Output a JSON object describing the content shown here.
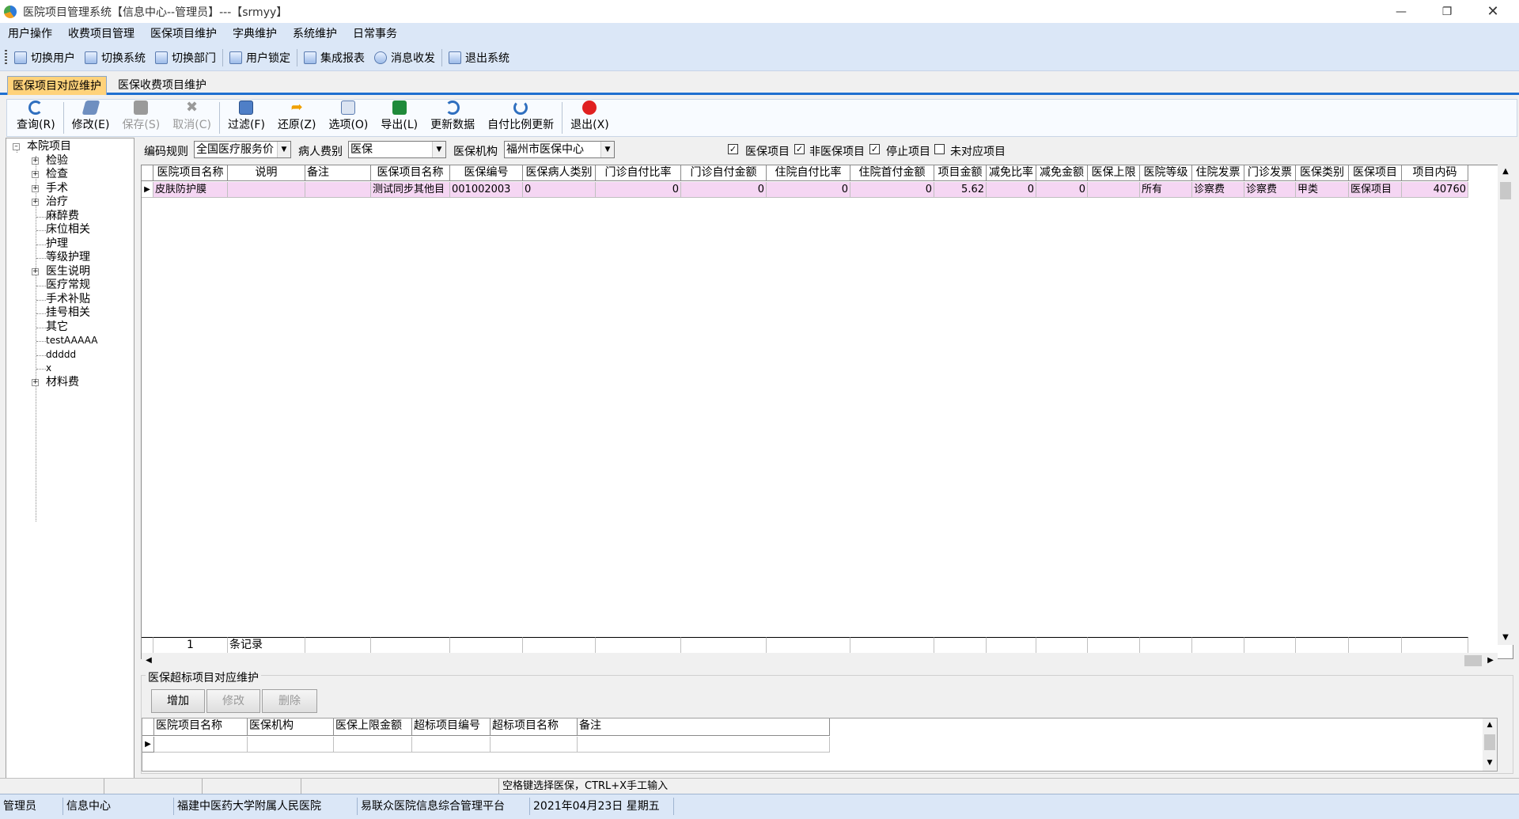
{
  "window": {
    "title": "医院项目管理系统【信息中心--管理员】---【srmyy】"
  },
  "menu": [
    "用户操作",
    "收费项目管理",
    "医保项目维护",
    "字典维护",
    "系统维护",
    "日常事务"
  ],
  "system_toolbar": [
    "切换用户",
    "切换系统",
    "切换部门",
    "用户锁定",
    "集成报表",
    "消息收发",
    "退出系统"
  ],
  "tabs": [
    "医保项目对应维护",
    "医保收费项目维护"
  ],
  "toolbar": {
    "query": "查询(R)",
    "edit": "修改(E)",
    "save": "保存(S)",
    "cancel": "取消(C)",
    "filter": "过滤(F)",
    "restore": "还原(Z)",
    "options": "选项(O)",
    "export": "导出(L)",
    "refresh": "更新数据",
    "ratio_update": "自付比例更新",
    "exit": "退出(X)"
  },
  "tree": {
    "root": "本院项目",
    "items": [
      "检验",
      "检查",
      "手术",
      "治疗",
      "麻醉费",
      "床位相关",
      "护理",
      "等级护理",
      "医生说明",
      "医疗常规",
      "手术补贴",
      "挂号相关",
      "其它",
      "testAAAAA",
      "ddddd",
      "x",
      "材料费"
    ]
  },
  "filters": {
    "code_rule_label": "编码规则",
    "code_rule_value": "全国医疗服务价",
    "patient_type_label": "病人费别",
    "patient_type_value": "医保",
    "agency_label": "医保机构",
    "agency_value": "福州市医保中心",
    "chk1_label": "医保项目",
    "chk2_label": "非医保项目",
    "chk3_label": "停止项目",
    "chk4_label": "未对应项目"
  },
  "grid": {
    "columns": [
      "医院项目名称",
      "说明",
      "备注",
      "医保项目名称",
      "医保编号",
      "医保病人类别",
      "门诊自付比率",
      "门诊自付金额",
      "住院自付比率",
      "住院首付金额",
      "项目金额",
      "减免比率",
      "减免金额",
      "医保上限",
      "医院等级",
      "住院发票",
      "门诊发票",
      "医保类别",
      "医保项目",
      "项目内码"
    ],
    "rows": [
      [
        "皮肤防护膜",
        "",
        "",
        "测试同步其他目",
        "001002003",
        "0",
        "0",
        "0",
        "0",
        "0",
        "5.62",
        "0",
        "0",
        "",
        "所有",
        "诊察费",
        "诊察费",
        "甲类",
        "医保项目",
        "40760"
      ]
    ],
    "footer_count": "1",
    "footer_label": "条记录"
  },
  "overlimit": {
    "title": "医保超标项目对应维护",
    "add": "增加",
    "edit": "修改",
    "delete": "删除",
    "columns": [
      "医院项目名称",
      "医保机构",
      "医保上限金额",
      "超标项目编号",
      "超标项目名称",
      "备注"
    ]
  },
  "status1": {
    "hint": "空格键选择医保，CTRL+X手工输入"
  },
  "status2": [
    "管理员",
    "信息中心",
    "福建中医药大学附属人民医院",
    "易联众医院信息综合管理平台",
    "2021年04月23日  星期五"
  ]
}
